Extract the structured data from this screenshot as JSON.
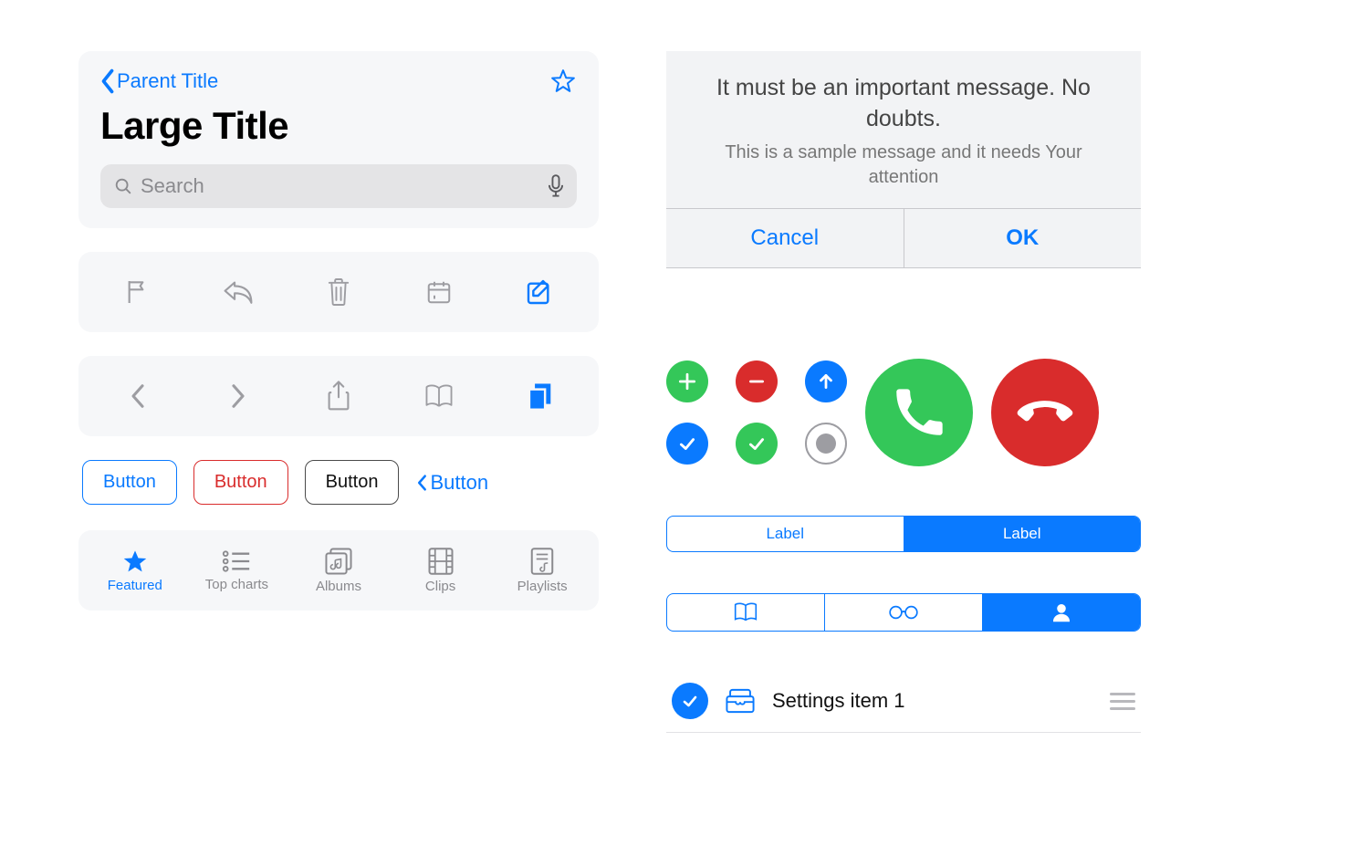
{
  "nav": {
    "parent": "Parent Title",
    "large_title": "Large Title"
  },
  "search": {
    "placeholder": "Search"
  },
  "buttons": {
    "b1": "Button",
    "b2": "Button",
    "b3": "Button",
    "b4": "Button"
  },
  "tabs": {
    "t1": "Featured",
    "t2": "Top charts",
    "t3": "Albums",
    "t4": "Clips",
    "t5": "Playlists"
  },
  "dialog": {
    "title": "It must be an important message. No doubts.",
    "message": "This is a sample message and it needs Your attention",
    "cancel": "Cancel",
    "ok": "OK"
  },
  "segmented": {
    "s1": "Label",
    "s2": "Label"
  },
  "list": {
    "item1": "Settings item 1"
  }
}
